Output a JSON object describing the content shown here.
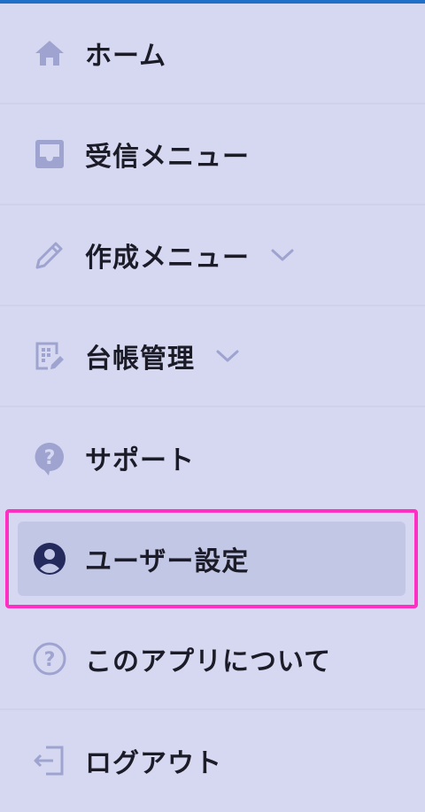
{
  "menu": {
    "items": [
      {
        "label": "ホーム",
        "icon": "home-icon"
      },
      {
        "label": "受信メニュー",
        "icon": "inbox-icon"
      },
      {
        "label": "作成メニュー",
        "icon": "pencil-icon",
        "expandable": true
      },
      {
        "label": "台帳管理",
        "icon": "ledger-icon",
        "expandable": true
      },
      {
        "label": "サポート",
        "icon": "help-bubble-icon"
      },
      {
        "label": "ユーザー設定",
        "icon": "user-circle-icon",
        "selected": true
      },
      {
        "label": "このアプリについて",
        "icon": "question-circle-icon"
      },
      {
        "label": "ログアウト",
        "icon": "logout-icon"
      }
    ]
  },
  "colors": {
    "background": "#d6d8f1",
    "icon": "#9ea3cf",
    "selected_icon": "#252a5c",
    "selected_bg": "#c3c7e6",
    "highlight": "#ff2fc4",
    "text": "#1c1c28"
  }
}
